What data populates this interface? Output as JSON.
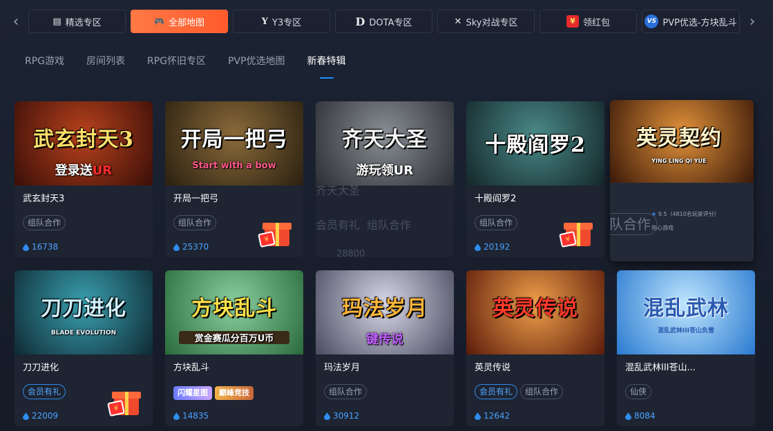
{
  "categories": [
    {
      "label": "精选专区",
      "icon": "▤",
      "icon_name": "featured-icon"
    },
    {
      "label": "全部地图",
      "icon": "🎮",
      "icon_name": "gamepad-icon",
      "active": true
    },
    {
      "label": "Y3专区",
      "icon": "Y",
      "icon_name": "y3-logo-icon"
    },
    {
      "label": "DOTA专区",
      "icon": "D",
      "icon_name": "dota-logo-icon"
    },
    {
      "label": "Sky对战专区",
      "icon": "✕",
      "icon_name": "crossed-swords-icon"
    },
    {
      "label": "领红包",
      "icon": "¥",
      "icon_name": "red-envelope-icon"
    },
    {
      "label": "PVP优选-方块乱斗",
      "icon": "VS",
      "icon_name": "vs-icon"
    }
  ],
  "subtabs": [
    {
      "label": "RPG游戏"
    },
    {
      "label": "房间列表"
    },
    {
      "label": "RPG怀旧专区"
    },
    {
      "label": "PVP优选地图"
    },
    {
      "label": "新春特辑",
      "active": true
    }
  ],
  "cards": [
    {
      "name": "武玄封天3",
      "art_title": "武玄封天3",
      "art_sub": "登录送",
      "art_sub_red": "UR",
      "tags": [
        "组队合作"
      ],
      "plays": "16738",
      "gift": false,
      "bg": "#5a1c0e"
    },
    {
      "name": "开局一把弓",
      "art_title": "开局一把弓",
      "art_sub": "Start with a bow",
      "art_sub_red": "",
      "tags": [
        "组队合作"
      ],
      "plays": "25370",
      "gift": true,
      "bg": "#4a3a22"
    },
    {
      "name": "齐天大圣",
      "art_title": "齐天大圣",
      "art_sub": "游玩领UR",
      "art_sub_red": "",
      "tags": [
        "会员有礼",
        "组队合作"
      ],
      "plays": "28800",
      "gift": false,
      "bg": "#4a4f55"
    },
    {
      "name": "十殿阎罗2",
      "art_title": "十殿阎罗2",
      "art_sub": "",
      "art_sub_red": "",
      "tags": [
        "组队合作"
      ],
      "plays": "20192",
      "gift": true,
      "bg": "#1f3a3f"
    },
    {
      "name": "英灵契约",
      "art_title": "英灵契约",
      "art_sub": "YING LING QI YUE",
      "art_sub_red": "",
      "rating": "9.5（4810名玩家评分）",
      "desc": "热心游戏",
      "ghost_tag": "队合作",
      "bg": "#7a3a1a"
    },
    {
      "name": "刀刀进化",
      "art_title": "刀刀进化",
      "art_sub": "BLADE EVOLUTION",
      "art_sub_red": "",
      "tags": [
        "会员有礼"
      ],
      "plays": "22009",
      "gift": true,
      "bg": "#1e4a5a"
    },
    {
      "name": "方块乱斗",
      "art_title": "方块乱斗",
      "art_sub": "赏金赛瓜分百万U币",
      "art_sub_red": "",
      "badges": [
        "闪耀星图",
        "巅峰竞技"
      ],
      "plays": "14835",
      "gift": false,
      "bg": "#3a7a4a"
    },
    {
      "name": "玛法岁月",
      "art_title": "玛法岁月",
      "art_sub": "键传说",
      "art_sub_red": "",
      "tags": [
        "组队合作"
      ],
      "plays": "30912",
      "gift": false,
      "bg": "#6a6a80"
    },
    {
      "name": "英灵传说",
      "art_title": "英灵传说",
      "art_sub": "",
      "art_sub_red": "",
      "tags": [
        "会员有礼",
        "组队合作"
      ],
      "plays": "12642",
      "gift": false,
      "bg": "#8a3a1a"
    },
    {
      "name": "混乱武林III苍山...",
      "art_title": "混乱武林",
      "art_sub": "混乱武林III苍山负雪",
      "art_sub_red": "",
      "tags": [
        "仙侠"
      ],
      "plays": "8084",
      "gift": false,
      "bg": "#3a8ad0"
    }
  ],
  "colors": {
    "accent": "#ff6b3a",
    "link": "#4aa3ff",
    "bg": "#171d29"
  }
}
